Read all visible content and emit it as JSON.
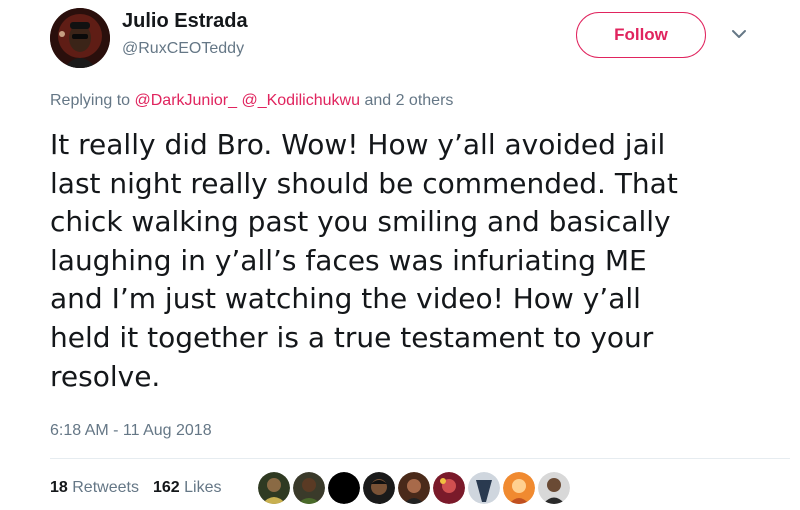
{
  "user": {
    "name": "Julio Estrada",
    "handle": "@RuxCEOTeddy",
    "avatar_icon": "profile-photo"
  },
  "actions": {
    "follow_label": "Follow",
    "more_icon": "chevron-down-icon"
  },
  "reply": {
    "prefix": "Replying to",
    "mention_1": "@DarkJunior_",
    "mention_2": "@_Kodilichukwu",
    "suffix": "and 2 others"
  },
  "tweet": {
    "text": "It really did Bro. Wow! How y’all avoided jail\nlast night really should be commended. That\nchick walking past you smiling and basically\nlaughing in y’all’s faces was infuriating ME\nand I’m just watching the video! How y’all\nheld it together is a true testament to your\nresolve."
  },
  "timestamp": "6:18 AM - 11 Aug 2018",
  "stats": {
    "retweets_count": "18",
    "retweets_label": "Retweets",
    "likes_count": "162",
    "likes_label": "Likes"
  },
  "colors": {
    "accent": "#e0245e",
    "secondary_text": "#657786",
    "primary_text": "#14171a"
  }
}
